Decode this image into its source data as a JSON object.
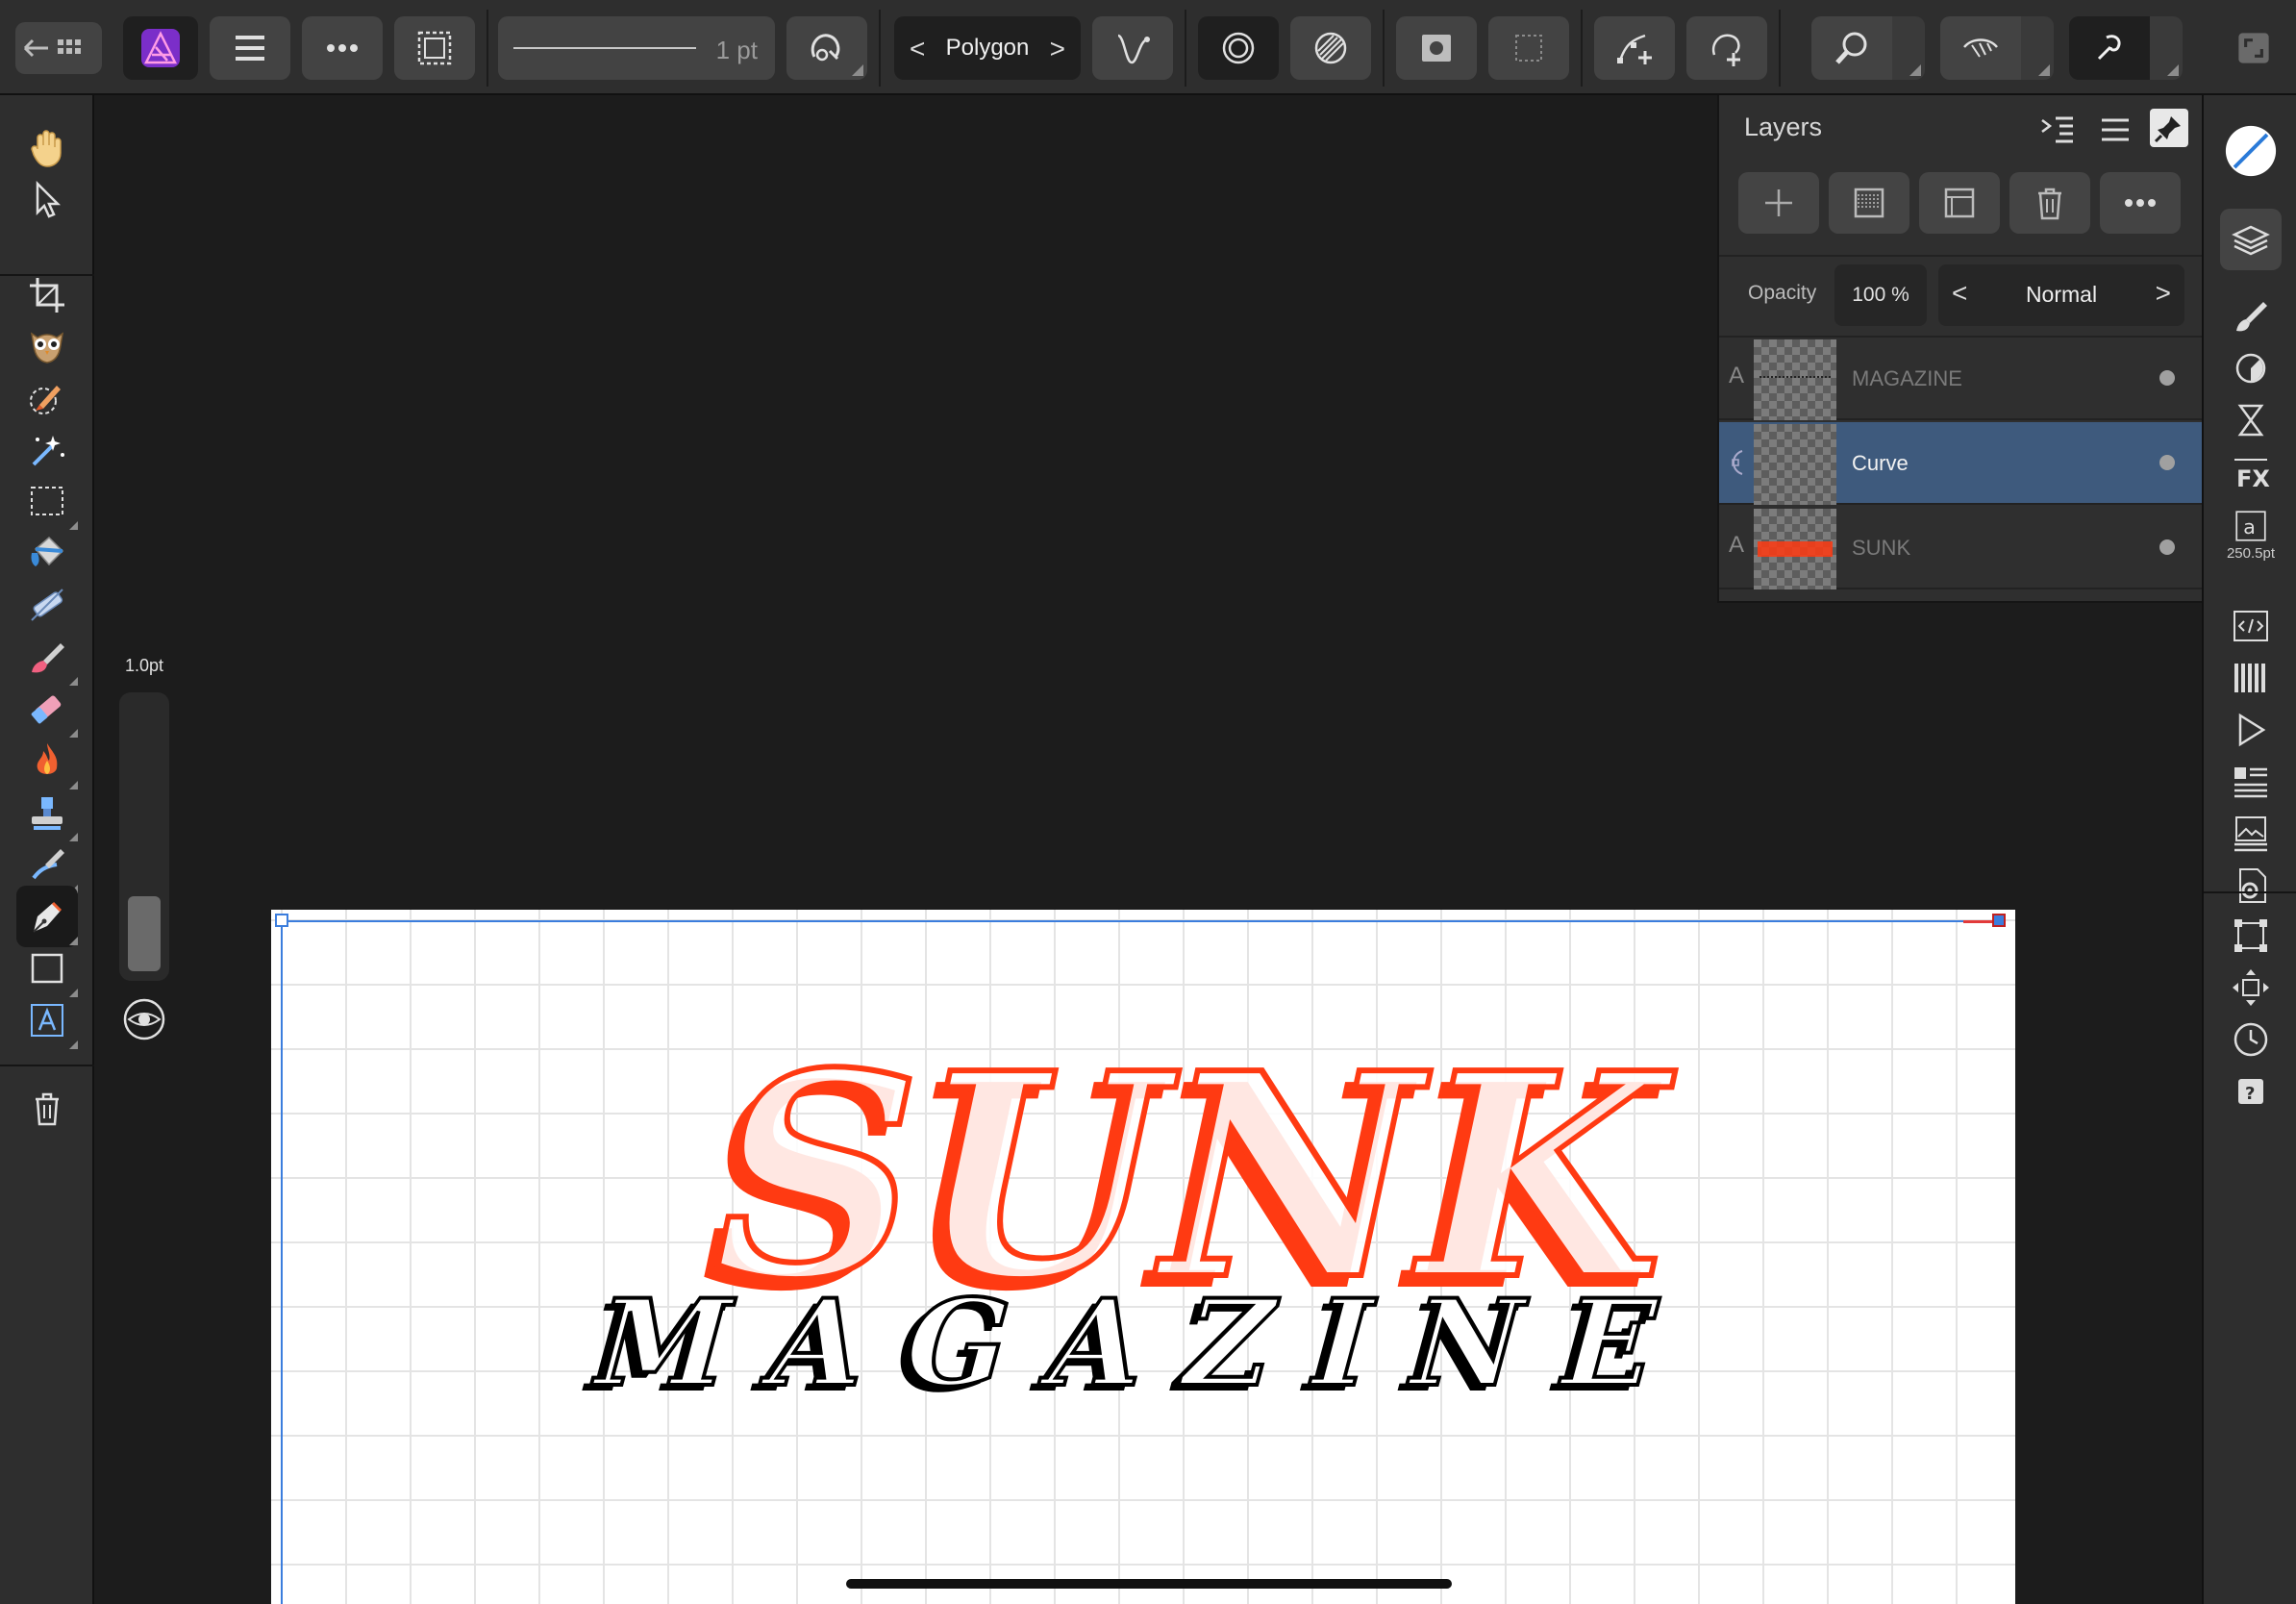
{
  "toolbar": {
    "stroke_width": "1 pt",
    "shape_label": "Polygon"
  },
  "layers_panel": {
    "title": "Layers",
    "opacity_label": "Opacity",
    "opacity_value": "100 %",
    "blend_mode": "Normal",
    "layers": [
      {
        "name": "MAGAZINE",
        "type_icon": "A",
        "selected": false
      },
      {
        "name": "Curve",
        "type_icon": "curve",
        "selected": true
      },
      {
        "name": "SUNK",
        "type_icon": "A",
        "selected": false
      }
    ]
  },
  "stroke_slider": {
    "label": "1.0pt"
  },
  "right_studio": {
    "text_size_label": "250.5pt"
  },
  "artwork": {
    "headline": "SUNK",
    "subheadline": "MAGAZINE",
    "headline_color": "#ff3a12",
    "subheadline_color": "#000000"
  },
  "colors": {
    "toolbar_bg": "#2e2e2e",
    "button_bg": "#434343",
    "selection_blue": "#3e5a7d"
  }
}
